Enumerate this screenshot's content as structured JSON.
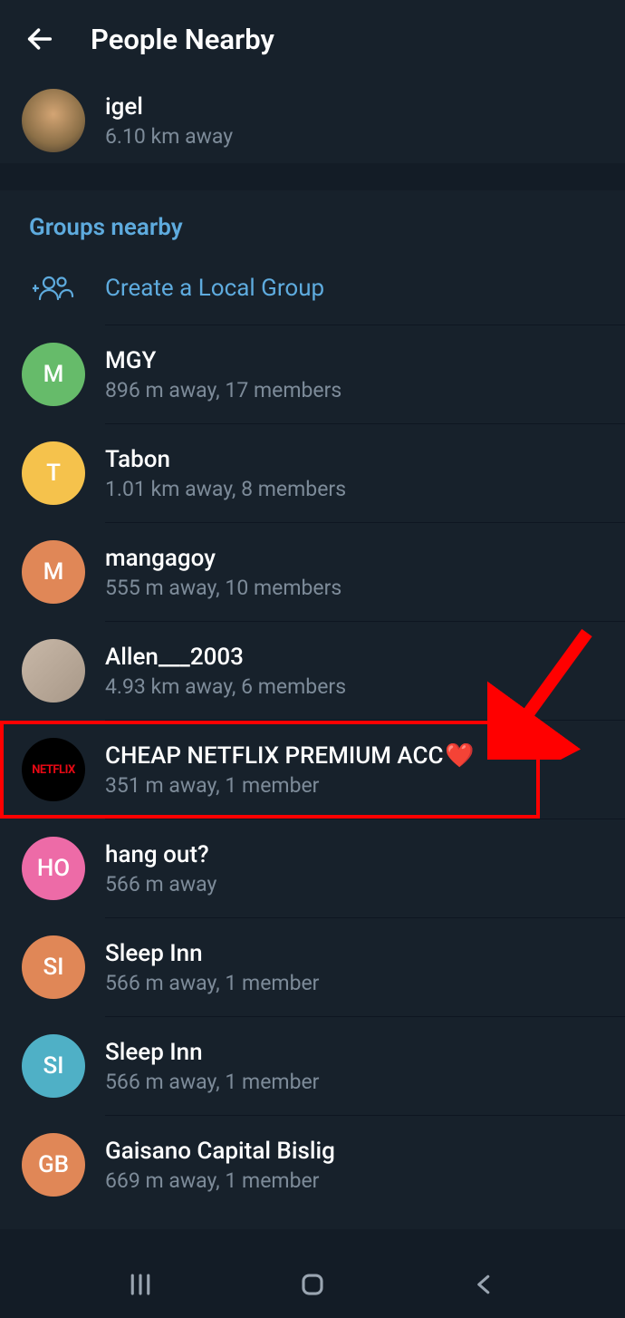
{
  "header": {
    "title": "People Nearby"
  },
  "top_user": {
    "name": "igel",
    "sub": "6.10 km away"
  },
  "section_label": "Groups nearby",
  "create_label": "Create a Local Group",
  "groups": [
    {
      "initial": "M",
      "color": "green",
      "name": "MGY",
      "sub": "896 m away, 17 members"
    },
    {
      "initial": "T",
      "color": "yellow",
      "name": "Tabon",
      "sub": "1.01 km away, 8 members"
    },
    {
      "initial": "M",
      "color": "orange",
      "name": "mangagoy",
      "sub": "555 m away, 10 members"
    },
    {
      "initial": "",
      "color": "photo2",
      "name": "Allen___2003",
      "sub": "4.93 km away, 6 members"
    },
    {
      "initial": "NETFLIX",
      "color": "netflix",
      "name": "CHEAP NETFLIX PREMIUM ACC",
      "sub": "351 m away, 1 member",
      "heart": "❤️",
      "highlighted": true
    },
    {
      "initial": "HO",
      "color": "pink",
      "name": "hang out?",
      "sub": "566 m away"
    },
    {
      "initial": "SI",
      "color": "orange",
      "name": "Sleep Inn",
      "sub": "566 m away, 1 member"
    },
    {
      "initial": "SI",
      "color": "lightblue",
      "name": "Sleep Inn",
      "sub": "566 m away, 1 member"
    },
    {
      "initial": "GB",
      "color": "orange",
      "name": "Gaisano Capital Bislig",
      "sub": "669 m away, 1 member"
    }
  ]
}
